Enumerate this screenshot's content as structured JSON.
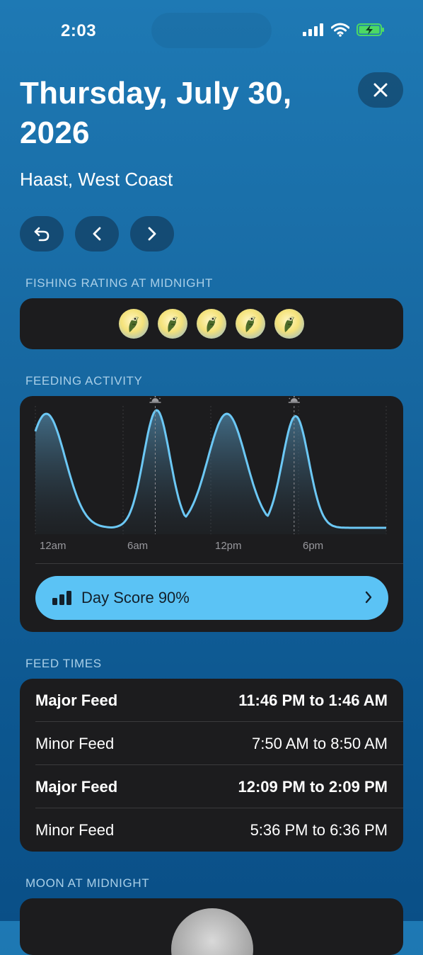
{
  "status_bar": {
    "time": "2:03"
  },
  "header": {
    "title": "Thursday, July 30, 2026",
    "location": "Haast, West Coast"
  },
  "sections": {
    "rating_label": "FISHING RATING AT MIDNIGHT",
    "activity_label": "FEEDING ACTIVITY",
    "feed_times_label": "FEED TIMES",
    "moon_label": "MOON AT MIDNIGHT"
  },
  "rating": {
    "fish_count": 5,
    "max": 5
  },
  "chart_data": {
    "type": "area",
    "x_ticks": [
      "12am",
      "6am",
      "12pm",
      "6pm"
    ],
    "peaks_hours": [
      0.75,
      8.3,
      13.1,
      17.8
    ],
    "sun_events_hours": [
      8.2,
      17.7
    ],
    "ylim": [
      0,
      1
    ]
  },
  "day_score": {
    "label": "Day Score 90%"
  },
  "feed_times": [
    {
      "name": "Major Feed",
      "time": "11:46 PM to 1:46 AM",
      "major": true
    },
    {
      "name": "Minor Feed",
      "time": "7:50 AM to 8:50 AM",
      "major": false
    },
    {
      "name": "Major Feed",
      "time": "12:09 PM to 2:09 PM",
      "major": true
    },
    {
      "name": "Minor Feed",
      "time": "5:36 PM to 6:36 PM",
      "major": false
    }
  ],
  "colors": {
    "accent": "#5bc3f5",
    "card": "#1c1c1e",
    "curve": "#6cc8f5"
  }
}
